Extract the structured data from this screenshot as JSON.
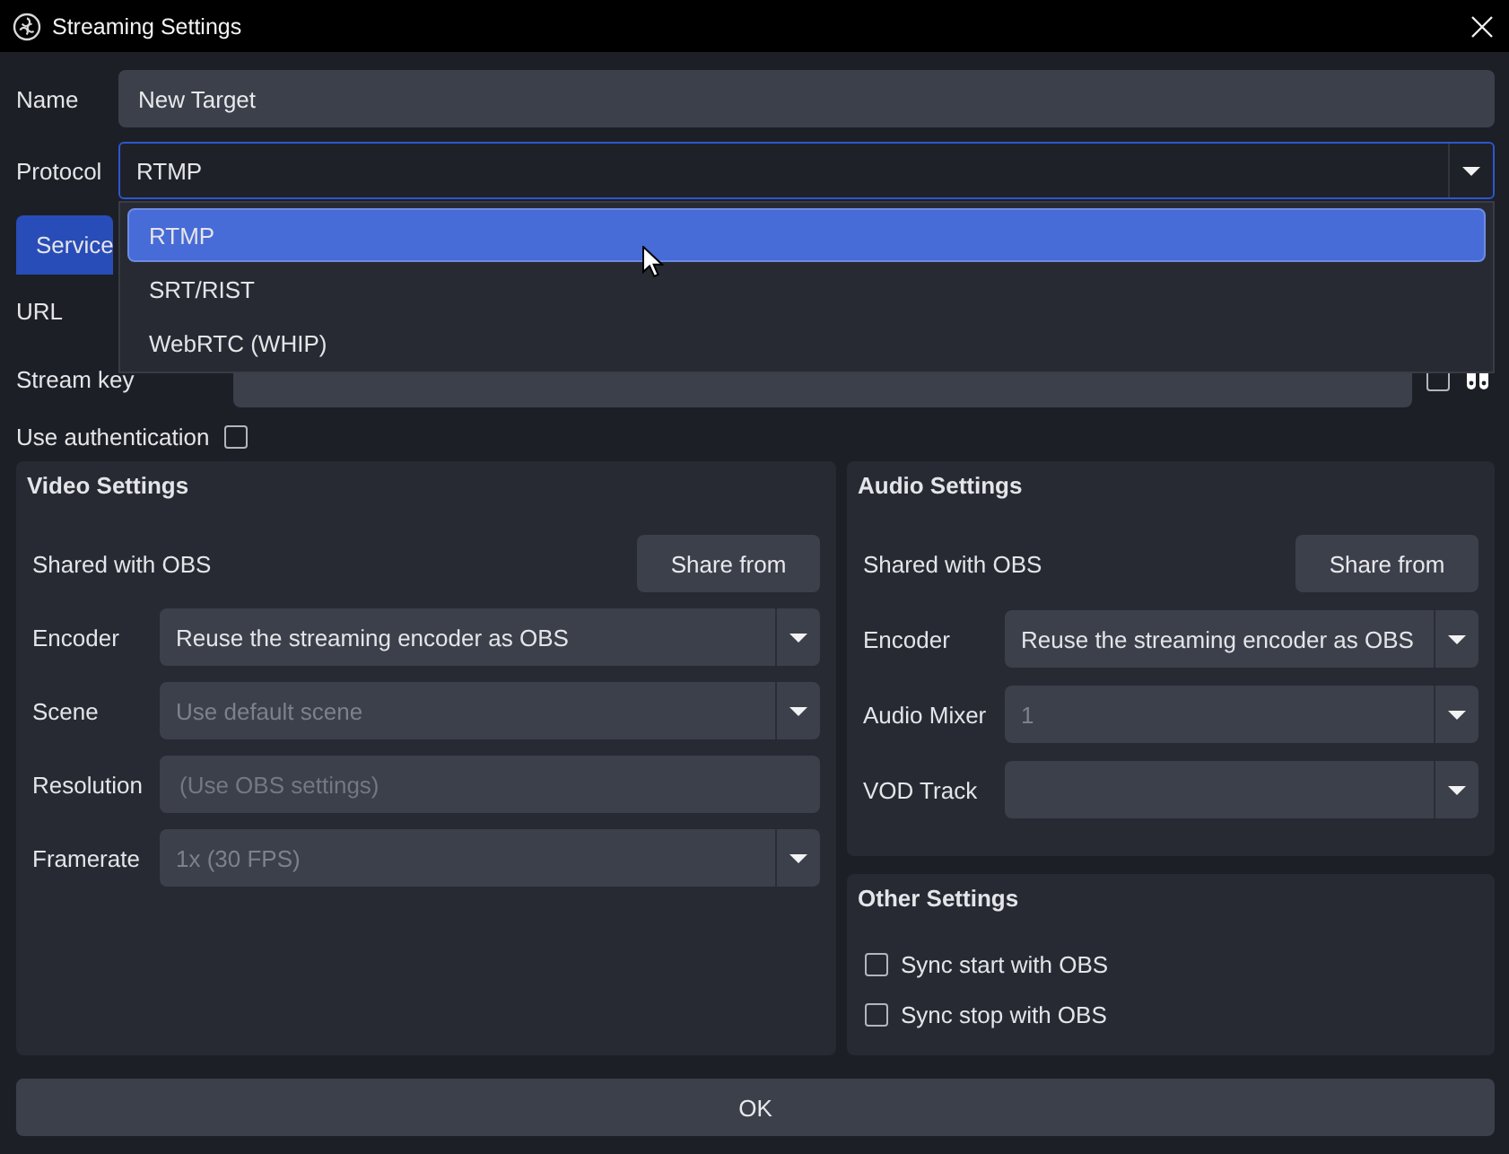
{
  "window": {
    "title": "Streaming Settings"
  },
  "name": {
    "label": "Name",
    "value": "New Target"
  },
  "protocol": {
    "label": "Protocol",
    "value": "RTMP",
    "expanded": true,
    "options": [
      {
        "label": "RTMP",
        "selected": true
      },
      {
        "label": "SRT/RIST",
        "selected": false
      },
      {
        "label": "WebRTC (WHIP)",
        "selected": false
      }
    ]
  },
  "tabs": [
    {
      "label": "Service",
      "selected": true
    }
  ],
  "url": {
    "label": "URL"
  },
  "stream_key": {
    "label": "Stream key",
    "show_checked": false
  },
  "authentication": {
    "label": "Use authentication",
    "checked": false
  },
  "video_settings": {
    "title": "Video Settings",
    "shared_label": "Shared with OBS",
    "share_button": "Share from",
    "fields": [
      {
        "kind": "combo",
        "label": "Encoder",
        "value": "Reuse the streaming encoder as OBS",
        "disabled": false
      },
      {
        "kind": "combo",
        "label": "Scene",
        "value": "Use default scene",
        "disabled": true
      },
      {
        "kind": "text",
        "label": "Resolution",
        "placeholder": "(Use OBS settings)"
      },
      {
        "kind": "combo",
        "label": "Framerate",
        "value": "1x (30 FPS)",
        "disabled": true
      }
    ]
  },
  "audio_settings": {
    "title": "Audio Settings",
    "shared_label": "Shared with OBS",
    "share_button": "Share from",
    "fields": [
      {
        "kind": "combo",
        "label": "Encoder",
        "value": "Reuse the streaming encoder as OBS",
        "disabled": false
      },
      {
        "kind": "combo",
        "label": "Audio Mixer",
        "value": "1",
        "disabled": true
      },
      {
        "kind": "combo",
        "label": "VOD Track"
      }
    ]
  },
  "other_settings": {
    "title": "Other Settings",
    "options": [
      {
        "label": "Sync start with OBS",
        "checked": false
      },
      {
        "label": "Sync stop with OBS",
        "checked": false
      }
    ]
  },
  "ok_button": "OK"
}
